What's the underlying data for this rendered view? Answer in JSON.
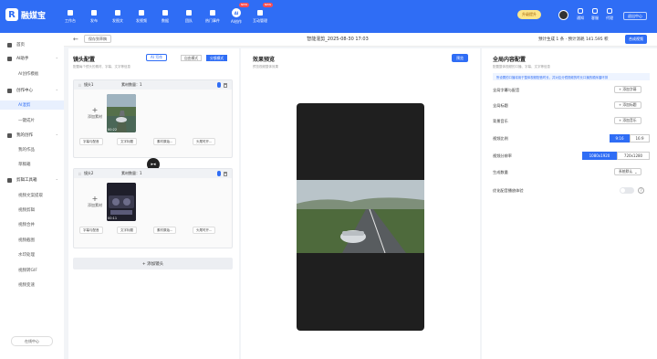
{
  "brand": {
    "name": "融媒宝"
  },
  "nav": [
    {
      "label": "工作台"
    },
    {
      "label": "发布"
    },
    {
      "label": "发图文"
    },
    {
      "label": "发视频"
    },
    {
      "label": "数据"
    },
    {
      "label": "团队"
    },
    {
      "label": "热门事件"
    },
    {
      "label": "AI创作",
      "badge": "NEW",
      "icon_text": "AI"
    },
    {
      "label": "互动管理",
      "badge": "NEW"
    }
  ],
  "user": {
    "upgrade": "升级提升",
    "icons": [
      "通知",
      "客服",
      "代理"
    ],
    "exit": "退出中心"
  },
  "sidebar": {
    "items": [
      {
        "label": "首页",
        "type": "group"
      },
      {
        "label": "AI助手",
        "type": "group"
      },
      {
        "label": "AI创作模板",
        "type": "sub"
      },
      {
        "label": "创作中心",
        "type": "group"
      },
      {
        "label": "AI混剪",
        "type": "sub",
        "active": true
      },
      {
        "label": "一键成片",
        "type": "sub"
      },
      {
        "label": "我的创作",
        "type": "group"
      },
      {
        "label": "我的作品",
        "type": "sub"
      },
      {
        "label": "草稿箱",
        "type": "sub"
      },
      {
        "label": "剪辑工具箱",
        "type": "group"
      },
      {
        "label": "视频文案提取",
        "type": "sub"
      },
      {
        "label": "视频剪辑",
        "type": "sub"
      },
      {
        "label": "视频合并",
        "type": "sub"
      },
      {
        "label": "视频截图",
        "type": "sub"
      },
      {
        "label": "水印处理",
        "type": "sub"
      },
      {
        "label": "视频转GIF",
        "type": "sub"
      },
      {
        "label": "视频变速",
        "type": "sub"
      }
    ],
    "service": "在线中心"
  },
  "header": {
    "save_draft": "保存到草稿",
    "title": "智能混剪_2025-08-30 17:03",
    "estimate": "预计生成 1 条 · 预计消耗 141.595 积",
    "synth": "合成视频"
  },
  "shots_panel": {
    "title": "镜头配置",
    "subtitle": "配置每个镜头的素材、字幕、文字等信息",
    "ai_write": "AI 写作",
    "modes": [
      "自由模式",
      "分镜模式"
    ],
    "shots": [
      {
        "name": "镜头1",
        "count": "素材数量：1",
        "time": "00:22"
      },
      {
        "name": "镜头2",
        "count": "素材数量：1",
        "time": "00:11"
      }
    ],
    "add_material": "添加素材",
    "chips": [
      "字幕与配音",
      "文字标题",
      "素材原始...",
      "头尾时开..."
    ],
    "add_shot": "+ 添加镜头"
  },
  "preview_panel": {
    "title": "效果预览",
    "subtitle": "预览视频整体效果",
    "preview_btn": "预览"
  },
  "global_panel": {
    "title": "全局内容配置",
    "subtitle": "配置整体视频的口播、字幕、文字等信息",
    "note": "所设置的口播将用于整体视频配音时长，并对应分镜视频的时长口播的顺序循环排",
    "rows": [
      {
        "label": "全局字幕与配音",
        "action": "+ 添加字幕"
      },
      {
        "label": "全局标题",
        "action": "+ 添加标题"
      },
      {
        "label": "背景音乐",
        "action": "+ 添加音乐"
      }
    ],
    "ratio_label": "视频比例",
    "ratios": [
      "9:16",
      "16:9"
    ],
    "resolution_label": "视频分辨率",
    "resolutions": [
      "1080x1920",
      "720x1280"
    ],
    "gen_label": "生成数量",
    "gen_value": "系统默认",
    "audio_label": "优化配音播放体验"
  }
}
